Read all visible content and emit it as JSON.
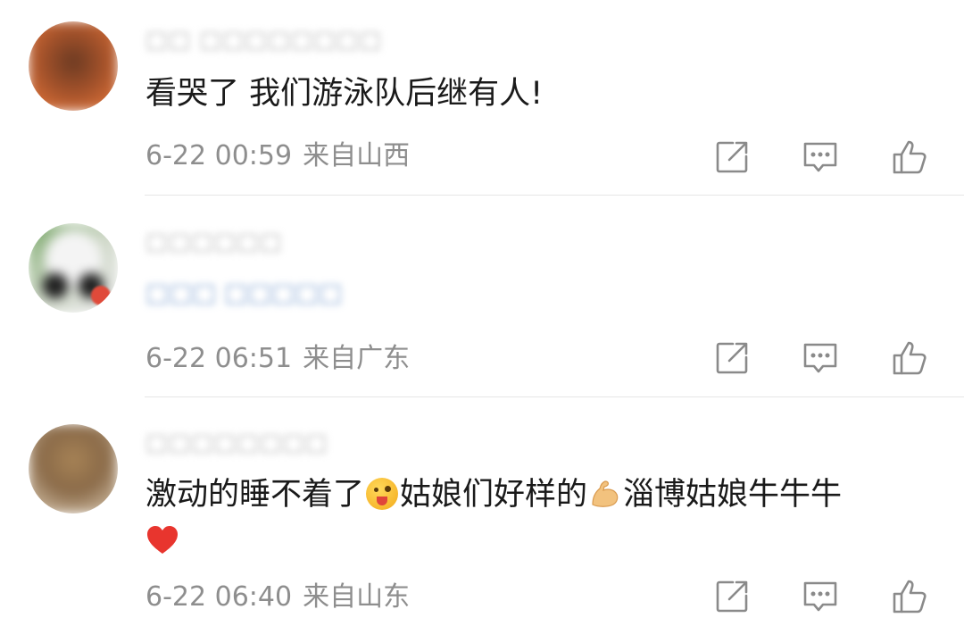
{
  "comments": [
    {
      "username": "□□ □□□□□□□□",
      "text": "看哭了 我们游泳队后继有人!",
      "date": "6-22 00:59",
      "location": "来自山西",
      "avatar_color": "#b5542a"
    },
    {
      "username": "□□□□□□",
      "badge": "□□□ □□□□□",
      "date": "6-22 06:51",
      "location": "来自广东",
      "avatar_color": "#4a4a4a"
    },
    {
      "username": "□□□□□□□□",
      "text_part1": "激动的睡不着了",
      "text_part2": "姑娘们好样的",
      "text_part3": "淄博姑娘牛牛牛",
      "emoji1": "tongue-face-emoji",
      "emoji2": "flexed-biceps-emoji",
      "emoji3": "red-heart-emoji",
      "date": "6-22 06:40",
      "location": "来自山东",
      "avatar_color": "#8a6a4a"
    }
  ],
  "icons": {
    "share": "share-icon",
    "comment": "comment-icon",
    "like": "like-icon"
  },
  "colors": {
    "meta_text": "#8e8e8e",
    "icon": "#8a8a8a",
    "divider": "#e6e6e6",
    "heart": "#e8352e"
  }
}
